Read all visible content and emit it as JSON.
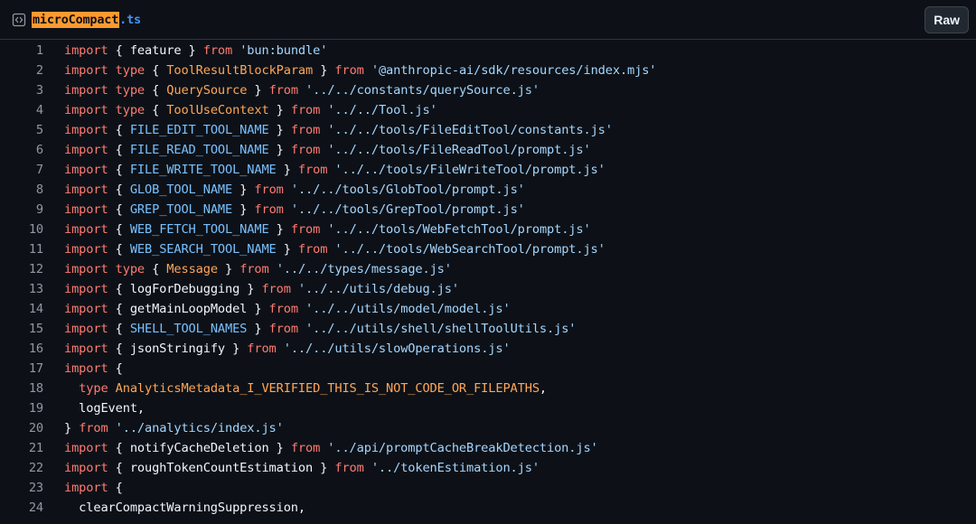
{
  "file": {
    "name_base": "microCompact",
    "name_ext": ".ts",
    "icon": "code-file-icon"
  },
  "toolbar": {
    "raw_label": "Raw"
  },
  "colors": {
    "background": "#0d1117",
    "keyword": "#ff7b72",
    "string": "#a5d6ff",
    "type": "#ffa657",
    "constant": "#79c0ff",
    "text": "#f0f6fc",
    "line_number": "#9198a1",
    "filename_highlight": "#ff9a2e",
    "filename_ext": "#4493f8"
  },
  "lines": [
    {
      "n": "1",
      "tokens": [
        [
          "kw",
          "import"
        ],
        [
          "plain",
          " { feature } "
        ],
        [
          "kw",
          "from"
        ],
        [
          "plain",
          " "
        ],
        [
          "str",
          "'bun:bundle'"
        ]
      ]
    },
    {
      "n": "2",
      "tokens": [
        [
          "kw",
          "import"
        ],
        [
          "plain",
          " "
        ],
        [
          "kw",
          "type"
        ],
        [
          "plain",
          " { "
        ],
        [
          "ty",
          "ToolResultBlockParam"
        ],
        [
          "plain",
          " } "
        ],
        [
          "kw",
          "from"
        ],
        [
          "plain",
          " "
        ],
        [
          "str",
          "'@anthropic-ai/sdk/resources/index.mjs'"
        ]
      ]
    },
    {
      "n": "3",
      "tokens": [
        [
          "kw",
          "import"
        ],
        [
          "plain",
          " "
        ],
        [
          "kw",
          "type"
        ],
        [
          "plain",
          " { "
        ],
        [
          "ty",
          "QuerySource"
        ],
        [
          "plain",
          " } "
        ],
        [
          "kw",
          "from"
        ],
        [
          "plain",
          " "
        ],
        [
          "str",
          "'../../constants/querySource.js'"
        ]
      ]
    },
    {
      "n": "4",
      "tokens": [
        [
          "kw",
          "import"
        ],
        [
          "plain",
          " "
        ],
        [
          "kw",
          "type"
        ],
        [
          "plain",
          " { "
        ],
        [
          "ty",
          "ToolUseContext"
        ],
        [
          "plain",
          " } "
        ],
        [
          "kw",
          "from"
        ],
        [
          "plain",
          " "
        ],
        [
          "str",
          "'../../Tool.js'"
        ]
      ]
    },
    {
      "n": "5",
      "tokens": [
        [
          "kw",
          "import"
        ],
        [
          "plain",
          " { "
        ],
        [
          "const",
          "FILE_EDIT_TOOL_NAME"
        ],
        [
          "plain",
          " } "
        ],
        [
          "kw",
          "from"
        ],
        [
          "plain",
          " "
        ],
        [
          "str",
          "'../../tools/FileEditTool/constants.js'"
        ]
      ]
    },
    {
      "n": "6",
      "tokens": [
        [
          "kw",
          "import"
        ],
        [
          "plain",
          " { "
        ],
        [
          "const",
          "FILE_READ_TOOL_NAME"
        ],
        [
          "plain",
          " } "
        ],
        [
          "kw",
          "from"
        ],
        [
          "plain",
          " "
        ],
        [
          "str",
          "'../../tools/FileReadTool/prompt.js'"
        ]
      ]
    },
    {
      "n": "7",
      "tokens": [
        [
          "kw",
          "import"
        ],
        [
          "plain",
          " { "
        ],
        [
          "const",
          "FILE_WRITE_TOOL_NAME"
        ],
        [
          "plain",
          " } "
        ],
        [
          "kw",
          "from"
        ],
        [
          "plain",
          " "
        ],
        [
          "str",
          "'../../tools/FileWriteTool/prompt.js'"
        ]
      ]
    },
    {
      "n": "8",
      "tokens": [
        [
          "kw",
          "import"
        ],
        [
          "plain",
          " { "
        ],
        [
          "const",
          "GLOB_TOOL_NAME"
        ],
        [
          "plain",
          " } "
        ],
        [
          "kw",
          "from"
        ],
        [
          "plain",
          " "
        ],
        [
          "str",
          "'../../tools/GlobTool/prompt.js'"
        ]
      ]
    },
    {
      "n": "9",
      "tokens": [
        [
          "kw",
          "import"
        ],
        [
          "plain",
          " { "
        ],
        [
          "const",
          "GREP_TOOL_NAME"
        ],
        [
          "plain",
          " } "
        ],
        [
          "kw",
          "from"
        ],
        [
          "plain",
          " "
        ],
        [
          "str",
          "'../../tools/GrepTool/prompt.js'"
        ]
      ]
    },
    {
      "n": "10",
      "tokens": [
        [
          "kw",
          "import"
        ],
        [
          "plain",
          " { "
        ],
        [
          "const",
          "WEB_FETCH_TOOL_NAME"
        ],
        [
          "plain",
          " } "
        ],
        [
          "kw",
          "from"
        ],
        [
          "plain",
          " "
        ],
        [
          "str",
          "'../../tools/WebFetchTool/prompt.js'"
        ]
      ]
    },
    {
      "n": "11",
      "tokens": [
        [
          "kw",
          "import"
        ],
        [
          "plain",
          " { "
        ],
        [
          "const",
          "WEB_SEARCH_TOOL_NAME"
        ],
        [
          "plain",
          " } "
        ],
        [
          "kw",
          "from"
        ],
        [
          "plain",
          " "
        ],
        [
          "str",
          "'../../tools/WebSearchTool/prompt.js'"
        ]
      ]
    },
    {
      "n": "12",
      "tokens": [
        [
          "kw",
          "import"
        ],
        [
          "plain",
          " "
        ],
        [
          "kw",
          "type"
        ],
        [
          "plain",
          " { "
        ],
        [
          "ty",
          "Message"
        ],
        [
          "plain",
          " } "
        ],
        [
          "kw",
          "from"
        ],
        [
          "plain",
          " "
        ],
        [
          "str",
          "'../../types/message.js'"
        ]
      ]
    },
    {
      "n": "13",
      "tokens": [
        [
          "kw",
          "import"
        ],
        [
          "plain",
          " { logForDebugging } "
        ],
        [
          "kw",
          "from"
        ],
        [
          "plain",
          " "
        ],
        [
          "str",
          "'../../utils/debug.js'"
        ]
      ]
    },
    {
      "n": "14",
      "tokens": [
        [
          "kw",
          "import"
        ],
        [
          "plain",
          " { getMainLoopModel } "
        ],
        [
          "kw",
          "from"
        ],
        [
          "plain",
          " "
        ],
        [
          "str",
          "'../../utils/model/model.js'"
        ]
      ]
    },
    {
      "n": "15",
      "tokens": [
        [
          "kw",
          "import"
        ],
        [
          "plain",
          " { "
        ],
        [
          "const",
          "SHELL_TOOL_NAMES"
        ],
        [
          "plain",
          " } "
        ],
        [
          "kw",
          "from"
        ],
        [
          "plain",
          " "
        ],
        [
          "str",
          "'../../utils/shell/shellToolUtils.js'"
        ]
      ]
    },
    {
      "n": "16",
      "tokens": [
        [
          "kw",
          "import"
        ],
        [
          "plain",
          " { jsonStringify } "
        ],
        [
          "kw",
          "from"
        ],
        [
          "plain",
          " "
        ],
        [
          "str",
          "'../../utils/slowOperations.js'"
        ]
      ]
    },
    {
      "n": "17",
      "tokens": [
        [
          "kw",
          "import"
        ],
        [
          "plain",
          " {"
        ]
      ]
    },
    {
      "n": "18",
      "tokens": [
        [
          "plain",
          "  "
        ],
        [
          "kw",
          "type"
        ],
        [
          "plain",
          " "
        ],
        [
          "ty",
          "AnalyticsMetadata_I_VERIFIED_THIS_IS_NOT_CODE_OR_FILEPATHS"
        ],
        [
          "plain",
          ","
        ]
      ]
    },
    {
      "n": "19",
      "tokens": [
        [
          "plain",
          "  logEvent,"
        ]
      ]
    },
    {
      "n": "20",
      "tokens": [
        [
          "plain",
          "} "
        ],
        [
          "kw",
          "from"
        ],
        [
          "plain",
          " "
        ],
        [
          "str",
          "'../analytics/index.js'"
        ]
      ]
    },
    {
      "n": "21",
      "tokens": [
        [
          "kw",
          "import"
        ],
        [
          "plain",
          " { notifyCacheDeletion } "
        ],
        [
          "kw",
          "from"
        ],
        [
          "plain",
          " "
        ],
        [
          "str",
          "'../api/promptCacheBreakDetection.js'"
        ]
      ]
    },
    {
      "n": "22",
      "tokens": [
        [
          "kw",
          "import"
        ],
        [
          "plain",
          " { roughTokenCountEstimation } "
        ],
        [
          "kw",
          "from"
        ],
        [
          "plain",
          " "
        ],
        [
          "str",
          "'../tokenEstimation.js'"
        ]
      ]
    },
    {
      "n": "23",
      "tokens": [
        [
          "kw",
          "import"
        ],
        [
          "plain",
          " {"
        ]
      ]
    },
    {
      "n": "24",
      "tokens": [
        [
          "plain",
          "  clearCompactWarningSuppression,"
        ]
      ]
    }
  ]
}
